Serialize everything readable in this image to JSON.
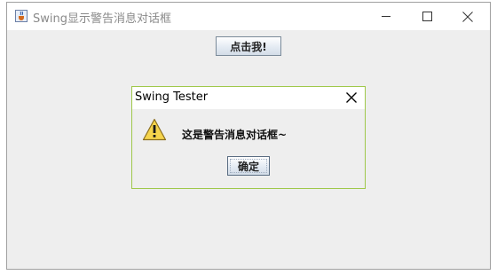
{
  "window": {
    "title": "Swing显示警告消息对话框",
    "app_icon": "java-cup-icon",
    "controls": [
      "minimize-icon",
      "maximize-icon",
      "close-icon"
    ]
  },
  "main": {
    "click_button_label": "点击我!"
  },
  "dialog": {
    "title": "Swing Tester",
    "close_icon": "close-icon",
    "icon": "warning-icon",
    "message": "这是警告消息对话框~",
    "ok_label": "确定"
  },
  "colors": {
    "dialog_border": "#9fc84a",
    "warning_fill": "#f5d44c",
    "background": "#eeeeee"
  }
}
